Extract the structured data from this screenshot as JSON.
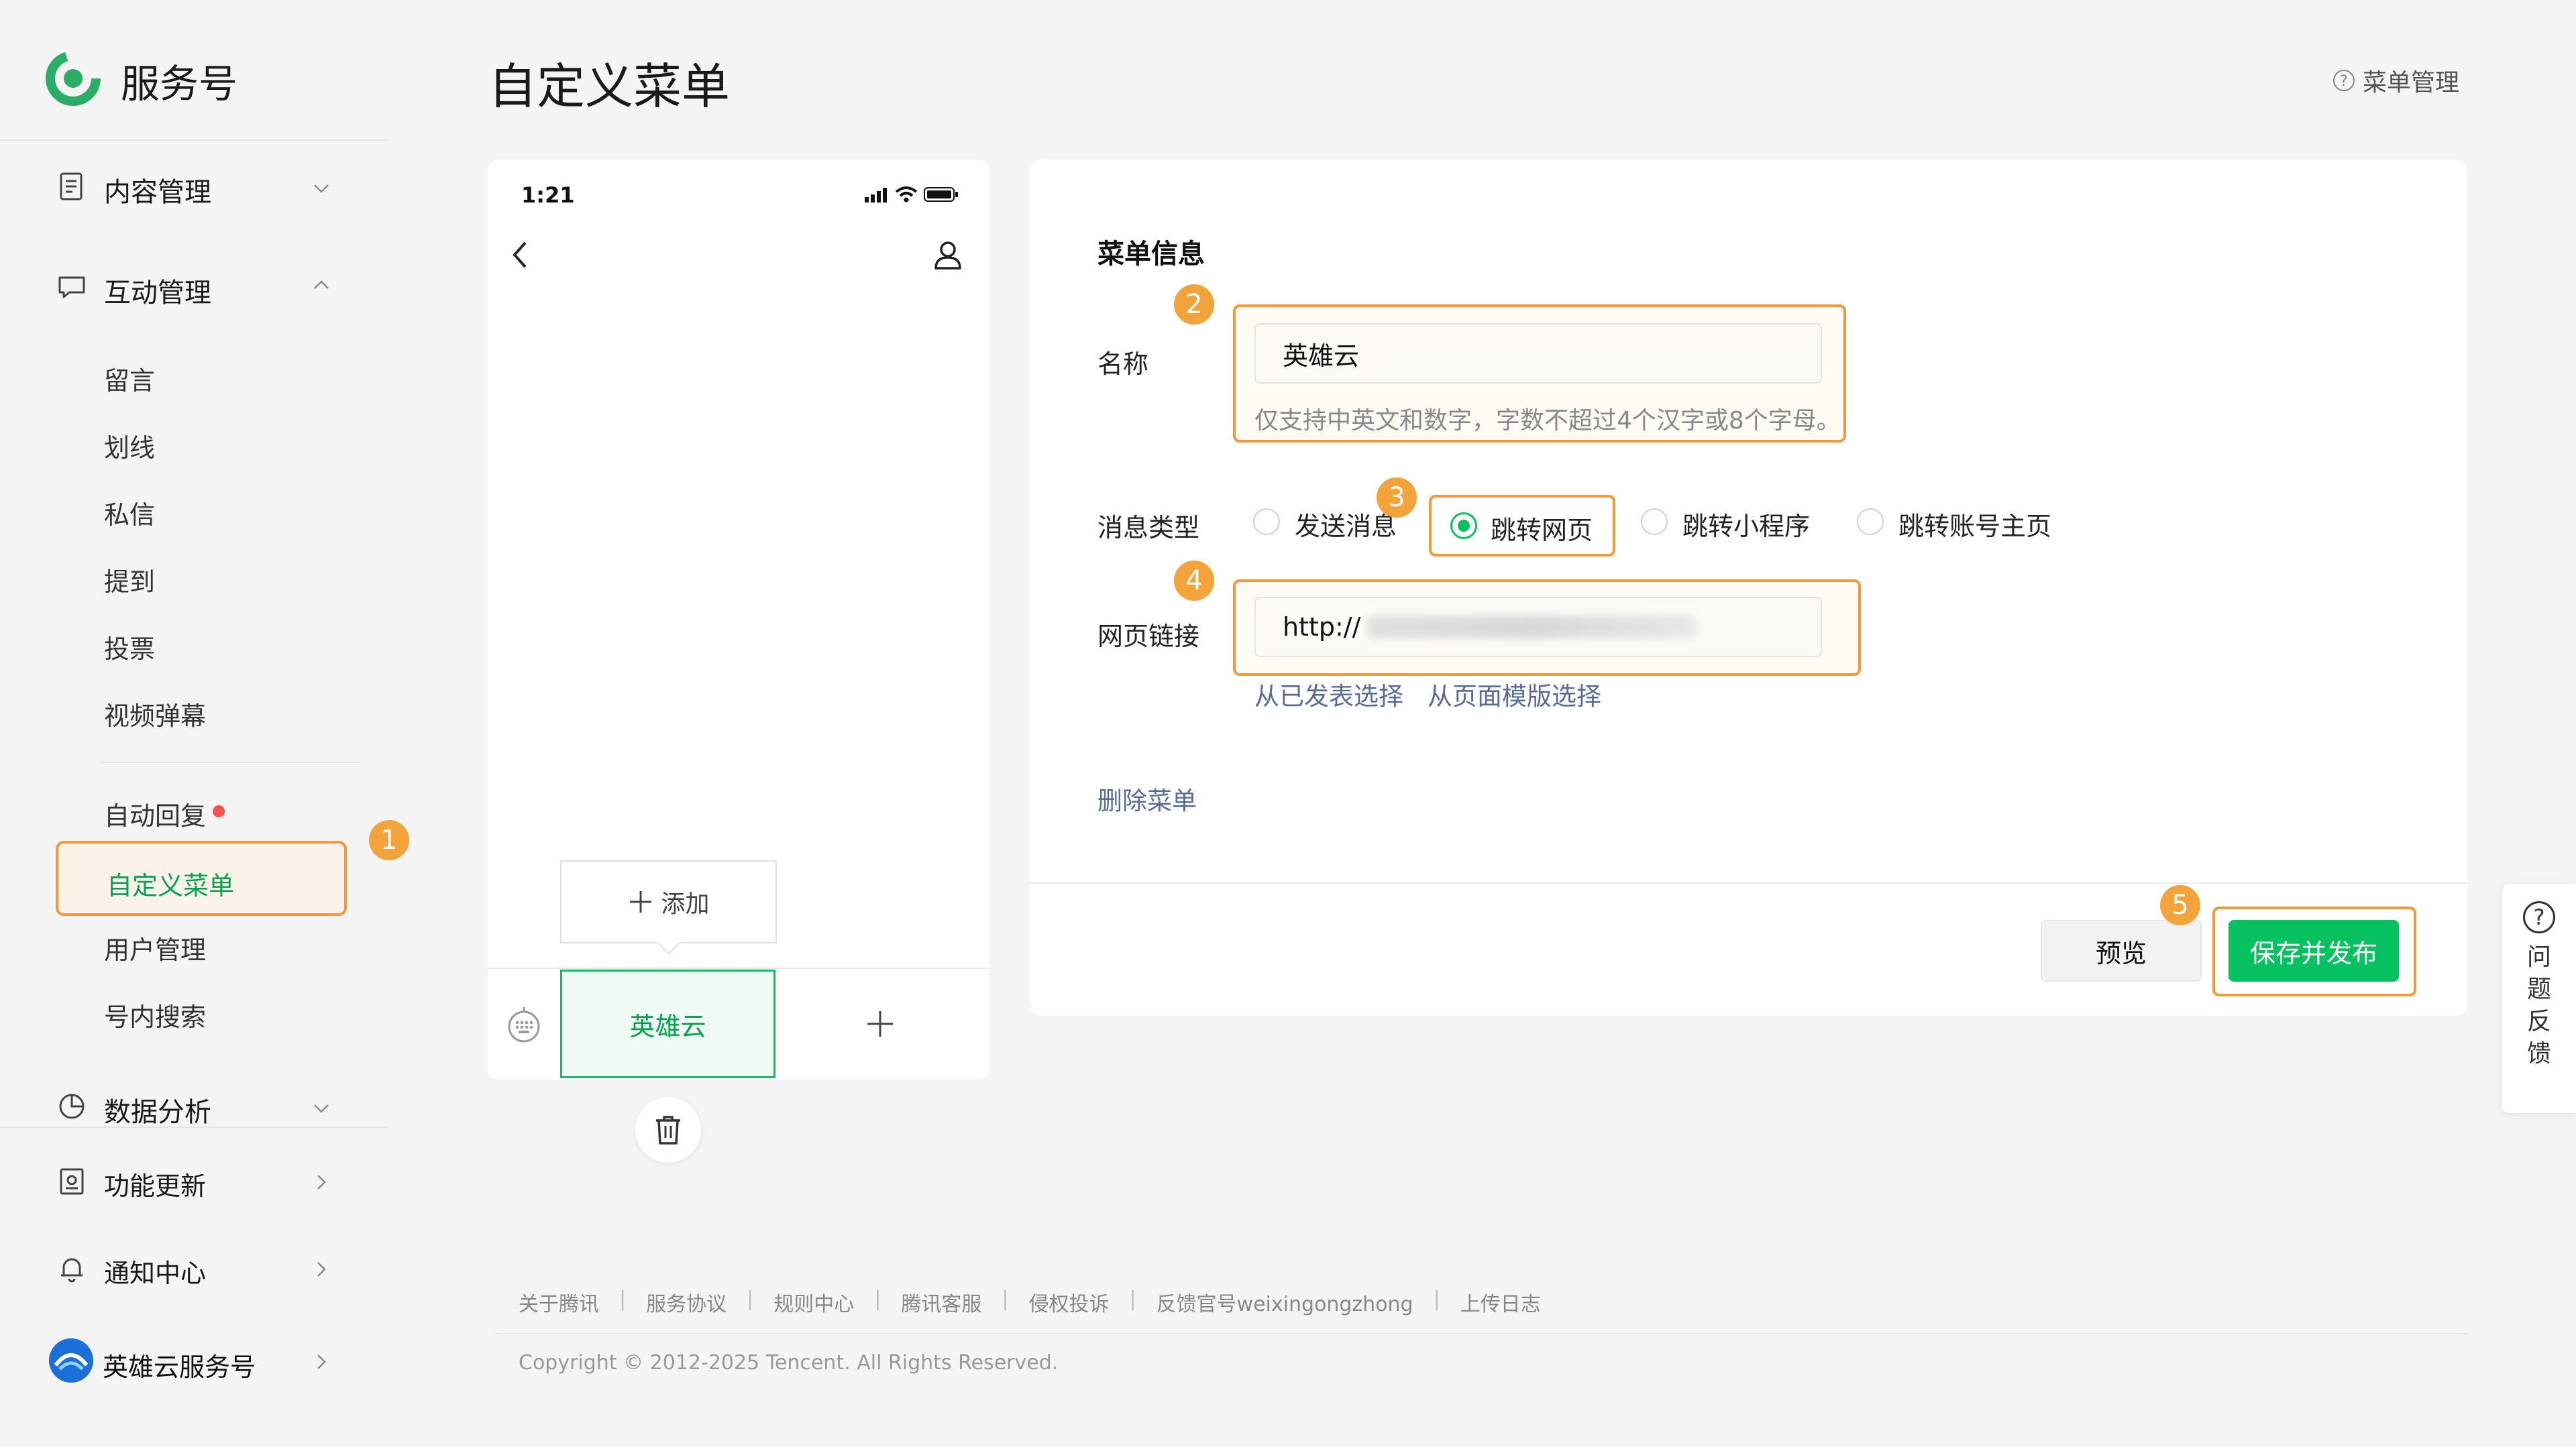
{
  "brand": {
    "name": "服务号",
    "logo_icon": "wechat-service-logo-icon"
  },
  "header": {
    "title": "自定义菜单",
    "help_label": "菜单管理"
  },
  "sidebar": {
    "content_mgmt": "内容管理",
    "interact_mgmt": "互动管理",
    "interact_items": [
      "留言",
      "划线",
      "私信",
      "提到",
      "投票",
      "视频弹幕"
    ],
    "auto_reply": "自动回复",
    "custom_menu": "自定义菜单",
    "user_mgmt": "用户管理",
    "in_account_search": "号内搜索",
    "data_analysis": "数据分析",
    "feature_update": "功能更新",
    "notification_center": "通知中心",
    "account_name": "英雄云服务号"
  },
  "badges": [
    "1",
    "2",
    "3",
    "4",
    "5"
  ],
  "phone": {
    "time": "1:21",
    "add_label": "添加",
    "menu_tab_label": "英雄云"
  },
  "form": {
    "section_title": "菜单信息",
    "name_label": "名称",
    "name_value": "英雄云",
    "name_hint": "仅支持中英文和数字，字数不超过4个汉字或8个字母。",
    "msg_type_label": "消息类型",
    "msg_types": [
      "发送消息",
      "跳转网页",
      "跳转小程序",
      "跳转账号主页"
    ],
    "selected_msg_type": "跳转网页",
    "url_label": "网页链接",
    "url_value": "http://",
    "pick_published": "从已发表选择",
    "pick_template": "从页面模版选择",
    "delete_menu": "删除菜单",
    "preview_btn": "预览",
    "publish_btn": "保存并发布"
  },
  "footer": {
    "links": [
      "关于腾讯",
      "服务协议",
      "规则中心",
      "腾讯客服",
      "侵权投诉",
      "反馈官号weixingongzhong",
      "上传日志"
    ],
    "copyright": "Copyright © 2012-2025 Tencent. All Rights Reserved."
  },
  "feedback": {
    "label": "问题反馈"
  },
  "colors": {
    "accent_green": "#07c160",
    "highlight_orange": "#f29a3b",
    "link_blue": "#576b95",
    "badge_orange": "#f2a33a"
  }
}
